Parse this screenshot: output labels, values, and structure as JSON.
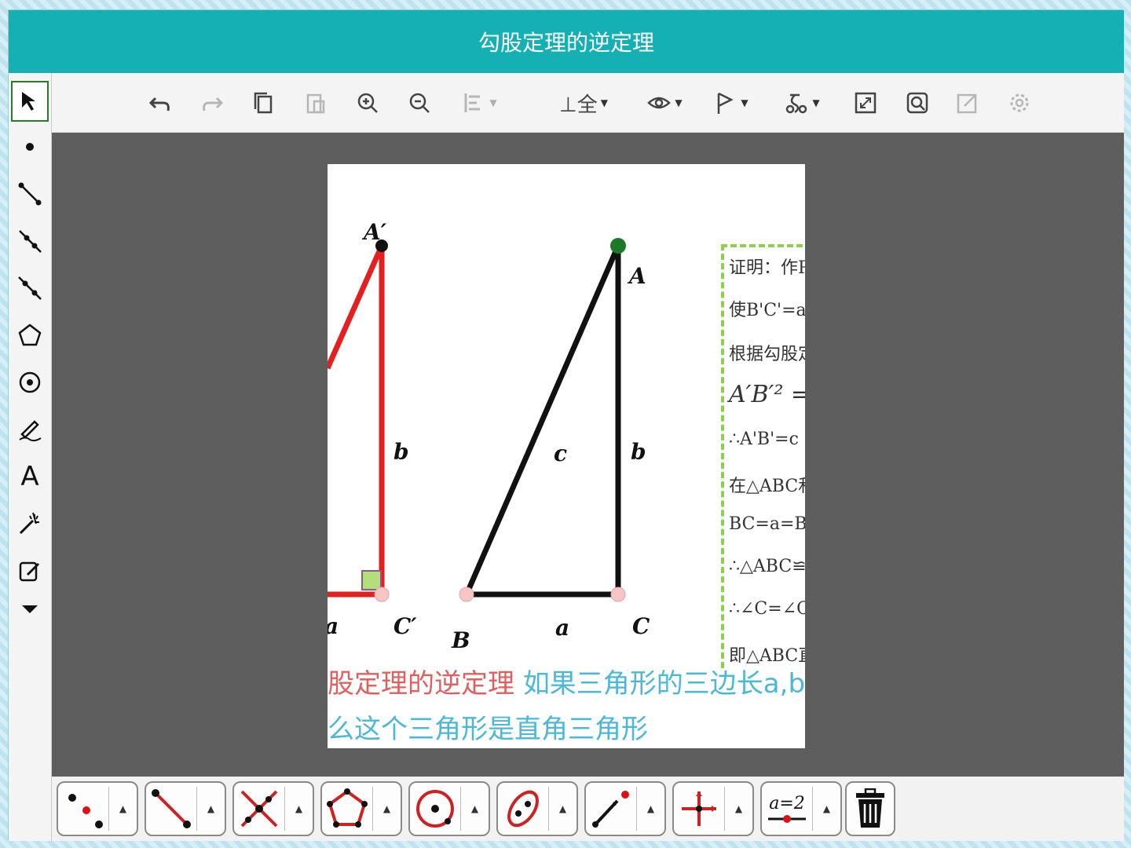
{
  "window": {
    "title": "勾股定理的逆定理"
  },
  "toolbar": {
    "items": [
      {
        "name": "undo-icon"
      },
      {
        "name": "redo-icon"
      },
      {
        "name": "copy-icon"
      },
      {
        "name": "paste-icon"
      },
      {
        "name": "zoom-in-icon"
      },
      {
        "name": "zoom-out-icon"
      },
      {
        "name": "align-icon"
      },
      {
        "name": "axes-icon",
        "label": "⊥全"
      },
      {
        "name": "eye-icon"
      },
      {
        "name": "flag-icon"
      },
      {
        "name": "animation-icon"
      },
      {
        "name": "fullscreen-icon"
      },
      {
        "name": "search-icon"
      },
      {
        "name": "edit-icon"
      },
      {
        "name": "settings-icon"
      }
    ]
  },
  "sidebar": {
    "tools": [
      {
        "name": "select-arrow-icon",
        "selected": true
      },
      {
        "name": "point-icon"
      },
      {
        "name": "segment-icon"
      },
      {
        "name": "ray-icon"
      },
      {
        "name": "line-icon"
      },
      {
        "name": "polygon-icon"
      },
      {
        "name": "circle-icon"
      },
      {
        "name": "pen-icon"
      },
      {
        "name": "text-icon",
        "label": "A"
      },
      {
        "name": "magic-wand-icon"
      },
      {
        "name": "note-edit-icon"
      },
      {
        "name": "more-down-icon"
      }
    ]
  },
  "figure": {
    "left_triangle": {
      "vertex_top": "A′",
      "side_vertical": "b",
      "vertex_bottom_right": "C′",
      "partial_label": "a",
      "color": "#e41f1f"
    },
    "right_triangle": {
      "vertex_top": "A",
      "vertex_left": "B",
      "vertex_right": "C",
      "side_hyp": "c",
      "side_vertical": "b",
      "side_base": "a",
      "color": "#111111"
    }
  },
  "proof": {
    "lines": [
      "证明：作R",
      "使B'C'=a,A",
      "根据勾股定",
      "A′B′² =",
      "∴A'B'=c",
      "在△ABC和",
      "BC=a=B'C",
      "∴△ABC≌△",
      "∴∠C=∠C'",
      "即△ABC直"
    ]
  },
  "theorem": {
    "title": "股定理的逆定理",
    "body": "如果三角形的三边长a,b,c满",
    "line2": "么这个三角形是直角三角形",
    "title_color": "#e06060",
    "body_color": "#4cb8d8"
  },
  "bottom_tools": [
    {
      "name": "point-tool-icon"
    },
    {
      "name": "segment-tool-icon"
    },
    {
      "name": "intersect-tool-icon"
    },
    {
      "name": "polygon-tool-icon"
    },
    {
      "name": "circle-tool-icon"
    },
    {
      "name": "ellipse-tool-icon"
    },
    {
      "name": "ray-tool-icon"
    },
    {
      "name": "axes-tool-icon"
    },
    {
      "name": "slider-tool-icon",
      "label": "a=2"
    }
  ],
  "colors": {
    "title_bg": "#15b0b4",
    "canvas_bg": "#5f5e5e",
    "proof_border": "#8fd04a"
  }
}
